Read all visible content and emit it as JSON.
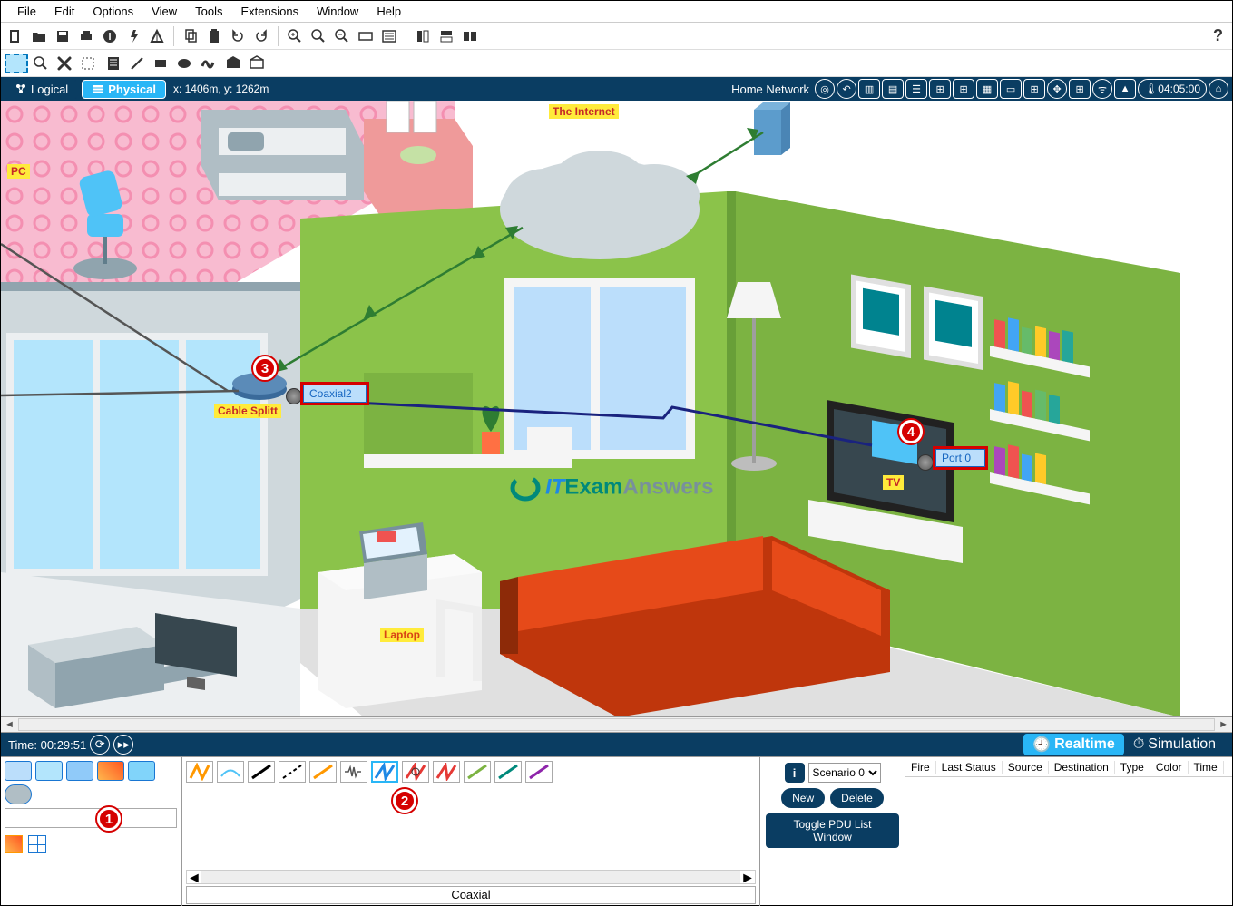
{
  "menu": {
    "file": "File",
    "edit": "Edit",
    "options": "Options",
    "view": "View",
    "tools": "Tools",
    "extensions": "Extensions",
    "window": "Window",
    "help": "Help"
  },
  "nav": {
    "logical": "Logical",
    "physical": "Physical",
    "coords": "x: 1406m, y: 1262m",
    "location": "Home Network",
    "clock": "04:05:00"
  },
  "workspace": {
    "internet_label": "The Internet",
    "pc_label": "PC",
    "splitter_label": "Cable Splitt",
    "coaxial_label": "Coaxial2",
    "tv_label": "TV",
    "port_label": "Port 0",
    "laptop_label": "Laptop",
    "watermark_it": "IT",
    "watermark_exam": "Exam",
    "watermark_answers": "Answers"
  },
  "markers": {
    "m1": "1",
    "m2": "2",
    "m3": "3",
    "m4": "4"
  },
  "timebar": {
    "label": "Time: 00:29:51",
    "realtime": "Realtime",
    "simulation": "Simulation"
  },
  "bottom": {
    "selected_cable": "Coaxial",
    "scenario": "Scenario 0",
    "new_btn": "New",
    "delete_btn": "Delete",
    "toggle_btn": "Toggle PDU List Window",
    "headers": {
      "fire": "Fire",
      "last": "Last Status",
      "src": "Source",
      "dst": "Destination",
      "type": "Type",
      "color": "Color",
      "time": "Time"
    }
  }
}
